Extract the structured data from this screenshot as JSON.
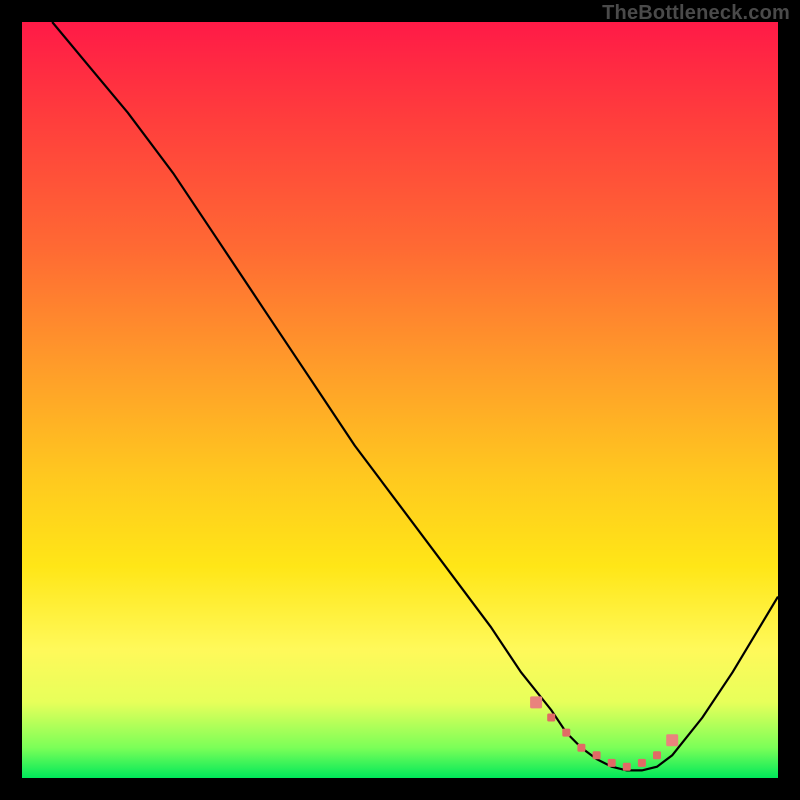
{
  "attribution": "TheBottleneck.com",
  "colors": {
    "curve": "#000000",
    "markers": "#e16a65",
    "marker_accent": "#e9837d"
  },
  "chart_data": {
    "type": "line",
    "title": "",
    "xlabel": "",
    "ylabel": "",
    "xlim": [
      0,
      100
    ],
    "ylim": [
      0,
      100
    ],
    "grid": false,
    "legend": false,
    "series": [
      {
        "name": "bottleneck-curve",
        "x": [
          4,
          9,
          14,
          20,
          26,
          32,
          38,
          44,
          50,
          56,
          62,
          66,
          70,
          72,
          74,
          76,
          78,
          80,
          82,
          84,
          86,
          90,
          94,
          100
        ],
        "y": [
          100,
          94,
          88,
          80,
          71,
          62,
          53,
          44,
          36,
          28,
          20,
          14,
          9,
          6,
          4,
          2.5,
          1.5,
          1,
          1,
          1.5,
          3,
          8,
          14,
          24
        ]
      }
    ],
    "markers": {
      "name": "optimum-band",
      "x": [
        68,
        70,
        72,
        74,
        76,
        78,
        80,
        82,
        84,
        86
      ],
      "y": [
        10,
        8,
        6,
        4,
        3,
        2,
        1.5,
        2,
        3,
        5
      ],
      "size_first_last": 6,
      "size_mid": 4
    }
  }
}
